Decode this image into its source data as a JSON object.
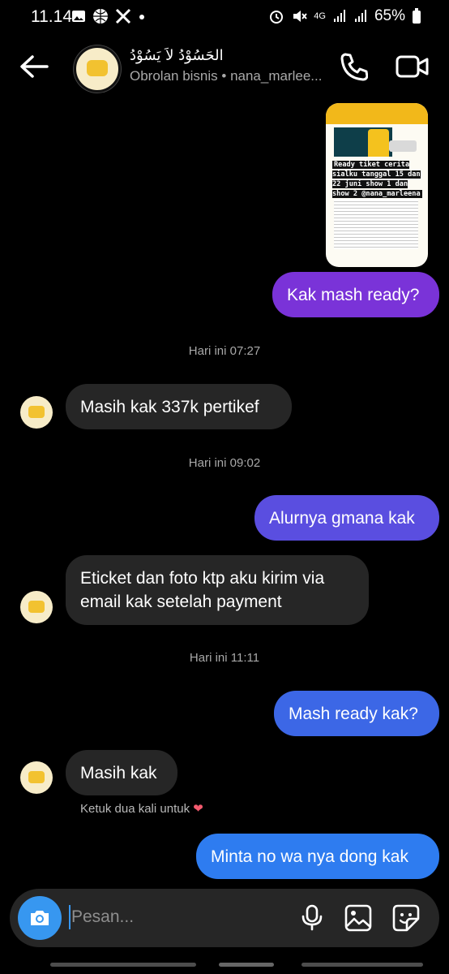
{
  "status_bar": {
    "time": "11.14",
    "network": "4G",
    "battery": "65%"
  },
  "header": {
    "title": "الحَسُوْدُ لاَ يَسُوْدُ",
    "subtitle": "Obrolan bisnis • nana_marlee..."
  },
  "media_caption": "Ready tiket cerita sialku tanggal 15 dan 22 juni show 1 dan show 2 @nana_marleena",
  "messages": [
    {
      "text": "Kak mash ready?"
    },
    {
      "timestamp": "Hari ini 07:27"
    },
    {
      "text": "Masih kak 337k pertikef"
    },
    {
      "timestamp": "Hari ini 09:02"
    },
    {
      "text": "Alurnya gmana kak"
    },
    {
      "text_line1": "Eticket dan foto ktp aku kirim via",
      "text_line2": "email kak setelah payment"
    },
    {
      "timestamp": "Hari ini 11:11"
    },
    {
      "text": "Mash ready kak?"
    },
    {
      "text": "Masih kak"
    },
    {
      "text": "Minta no wa nya dong kak"
    }
  ],
  "like_hint": "Ketuk dua kali untuk",
  "composer": {
    "placeholder": "Pesan..."
  },
  "colors": {
    "bubble_purple": "#7a33d8",
    "bubble_violet": "#5a4ee0",
    "bubble_blue": "#3c67e6",
    "bubble_bright_blue": "#2e7cf0",
    "incoming": "#262626",
    "accent": "#3797f0"
  }
}
